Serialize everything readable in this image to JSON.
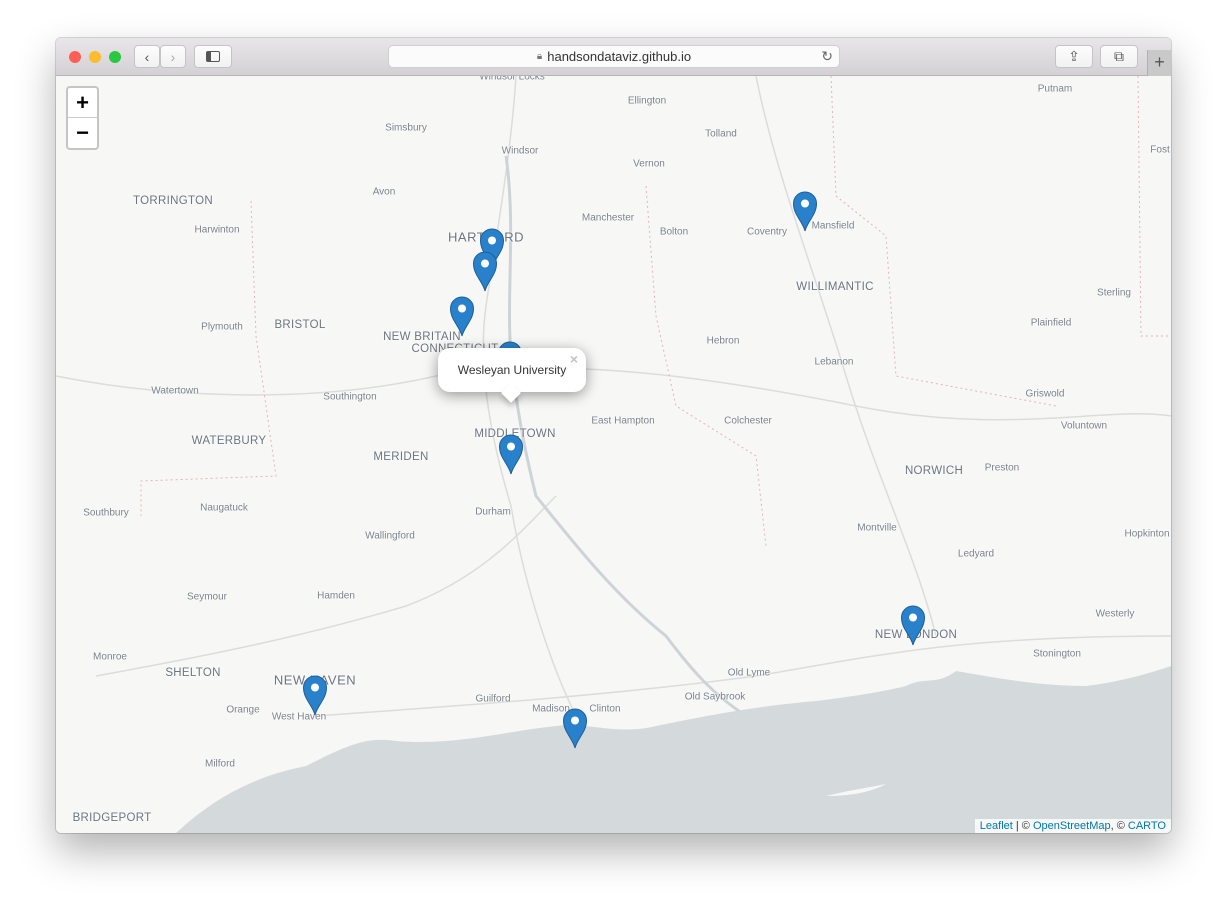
{
  "browser": {
    "url": "handsondataviz.github.io",
    "back_icon": "chevron-left",
    "forward_icon": "chevron-right"
  },
  "map": {
    "zoom_in": "+",
    "zoom_out": "−",
    "popup": {
      "text": "Wesleyan University",
      "close": "×"
    },
    "marker_color": "#2A81CB",
    "marker_count": 9,
    "attribution": {
      "leaflet": "Leaflet",
      "sep": " | © ",
      "osm": "OpenStreetMap",
      "sep2": ", © ",
      "carto": "CARTO"
    },
    "labels": [
      "Windsor Locks",
      "Ellington",
      "Putnam",
      "Simsbury",
      "Tolland",
      "Windsor",
      "Vernon",
      "Fost",
      "TORRINGTON",
      "Avon",
      "Manchester",
      "Harwinton",
      "HARTFORD",
      "Bolton",
      "Coventry",
      "Mansfield",
      "WILLIMANTIC",
      "Sterling",
      "Plymouth",
      "BRISTOL",
      "NEW BRITAIN",
      "CONNECTICUT",
      "Hebron",
      "Plainfield",
      "Lebanon",
      "Watertown",
      "Southington",
      "Griswold",
      "East Hampton",
      "Colchester",
      "Voluntown",
      "WATERBURY",
      "MERIDEN",
      "MIDDLETOWN",
      "NORWICH",
      "Preston",
      "Southbury",
      "Naugatuck",
      "Durham",
      "Wallingford",
      "Montville",
      "Ledyard",
      "Hopkinton",
      "Seymour",
      "Hamden",
      "Westerly",
      "NEW LONDON",
      "Monroe",
      "SHELTON",
      "NEW HAVEN",
      "Stonington",
      "Old Lyme",
      "Guilford",
      "Madison",
      "Clinton",
      "Old Saybrook",
      "Orange",
      "West Haven",
      "Milford",
      "BRIDGEPORT"
    ]
  }
}
